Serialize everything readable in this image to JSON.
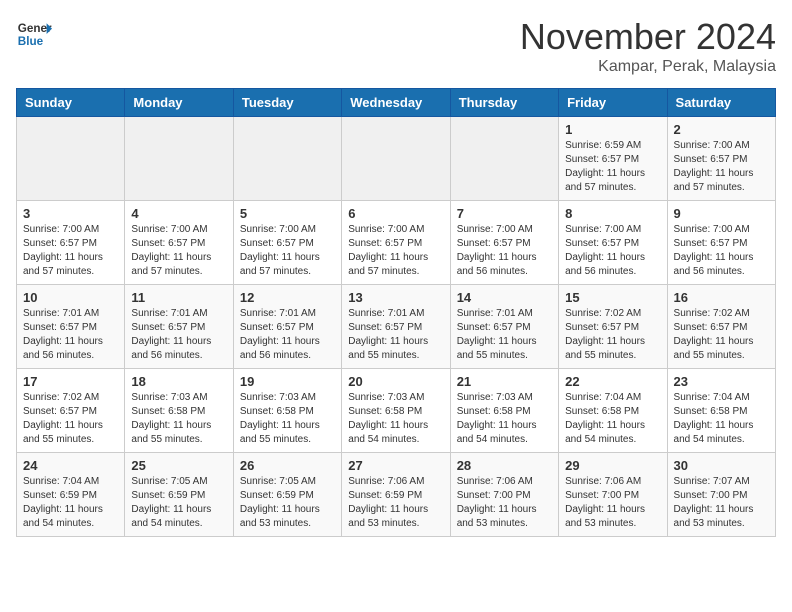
{
  "logo": {
    "general": "General",
    "blue": "Blue"
  },
  "title": "November 2024",
  "location": "Kampar, Perak, Malaysia",
  "weekdays": [
    "Sunday",
    "Monday",
    "Tuesday",
    "Wednesday",
    "Thursday",
    "Friday",
    "Saturday"
  ],
  "weeks": [
    [
      {
        "day": "",
        "info": ""
      },
      {
        "day": "",
        "info": ""
      },
      {
        "day": "",
        "info": ""
      },
      {
        "day": "",
        "info": ""
      },
      {
        "day": "",
        "info": ""
      },
      {
        "day": "1",
        "info": "Sunrise: 6:59 AM\nSunset: 6:57 PM\nDaylight: 11 hours and 57 minutes."
      },
      {
        "day": "2",
        "info": "Sunrise: 7:00 AM\nSunset: 6:57 PM\nDaylight: 11 hours and 57 minutes."
      }
    ],
    [
      {
        "day": "3",
        "info": "Sunrise: 7:00 AM\nSunset: 6:57 PM\nDaylight: 11 hours and 57 minutes."
      },
      {
        "day": "4",
        "info": "Sunrise: 7:00 AM\nSunset: 6:57 PM\nDaylight: 11 hours and 57 minutes."
      },
      {
        "day": "5",
        "info": "Sunrise: 7:00 AM\nSunset: 6:57 PM\nDaylight: 11 hours and 57 minutes."
      },
      {
        "day": "6",
        "info": "Sunrise: 7:00 AM\nSunset: 6:57 PM\nDaylight: 11 hours and 57 minutes."
      },
      {
        "day": "7",
        "info": "Sunrise: 7:00 AM\nSunset: 6:57 PM\nDaylight: 11 hours and 56 minutes."
      },
      {
        "day": "8",
        "info": "Sunrise: 7:00 AM\nSunset: 6:57 PM\nDaylight: 11 hours and 56 minutes."
      },
      {
        "day": "9",
        "info": "Sunrise: 7:00 AM\nSunset: 6:57 PM\nDaylight: 11 hours and 56 minutes."
      }
    ],
    [
      {
        "day": "10",
        "info": "Sunrise: 7:01 AM\nSunset: 6:57 PM\nDaylight: 11 hours and 56 minutes."
      },
      {
        "day": "11",
        "info": "Sunrise: 7:01 AM\nSunset: 6:57 PM\nDaylight: 11 hours and 56 minutes."
      },
      {
        "day": "12",
        "info": "Sunrise: 7:01 AM\nSunset: 6:57 PM\nDaylight: 11 hours and 56 minutes."
      },
      {
        "day": "13",
        "info": "Sunrise: 7:01 AM\nSunset: 6:57 PM\nDaylight: 11 hours and 55 minutes."
      },
      {
        "day": "14",
        "info": "Sunrise: 7:01 AM\nSunset: 6:57 PM\nDaylight: 11 hours and 55 minutes."
      },
      {
        "day": "15",
        "info": "Sunrise: 7:02 AM\nSunset: 6:57 PM\nDaylight: 11 hours and 55 minutes."
      },
      {
        "day": "16",
        "info": "Sunrise: 7:02 AM\nSunset: 6:57 PM\nDaylight: 11 hours and 55 minutes."
      }
    ],
    [
      {
        "day": "17",
        "info": "Sunrise: 7:02 AM\nSunset: 6:57 PM\nDaylight: 11 hours and 55 minutes."
      },
      {
        "day": "18",
        "info": "Sunrise: 7:03 AM\nSunset: 6:58 PM\nDaylight: 11 hours and 55 minutes."
      },
      {
        "day": "19",
        "info": "Sunrise: 7:03 AM\nSunset: 6:58 PM\nDaylight: 11 hours and 55 minutes."
      },
      {
        "day": "20",
        "info": "Sunrise: 7:03 AM\nSunset: 6:58 PM\nDaylight: 11 hours and 54 minutes."
      },
      {
        "day": "21",
        "info": "Sunrise: 7:03 AM\nSunset: 6:58 PM\nDaylight: 11 hours and 54 minutes."
      },
      {
        "day": "22",
        "info": "Sunrise: 7:04 AM\nSunset: 6:58 PM\nDaylight: 11 hours and 54 minutes."
      },
      {
        "day": "23",
        "info": "Sunrise: 7:04 AM\nSunset: 6:58 PM\nDaylight: 11 hours and 54 minutes."
      }
    ],
    [
      {
        "day": "24",
        "info": "Sunrise: 7:04 AM\nSunset: 6:59 PM\nDaylight: 11 hours and 54 minutes."
      },
      {
        "day": "25",
        "info": "Sunrise: 7:05 AM\nSunset: 6:59 PM\nDaylight: 11 hours and 54 minutes."
      },
      {
        "day": "26",
        "info": "Sunrise: 7:05 AM\nSunset: 6:59 PM\nDaylight: 11 hours and 53 minutes."
      },
      {
        "day": "27",
        "info": "Sunrise: 7:06 AM\nSunset: 6:59 PM\nDaylight: 11 hours and 53 minutes."
      },
      {
        "day": "28",
        "info": "Sunrise: 7:06 AM\nSunset: 7:00 PM\nDaylight: 11 hours and 53 minutes."
      },
      {
        "day": "29",
        "info": "Sunrise: 7:06 AM\nSunset: 7:00 PM\nDaylight: 11 hours and 53 minutes."
      },
      {
        "day": "30",
        "info": "Sunrise: 7:07 AM\nSunset: 7:00 PM\nDaylight: 11 hours and 53 minutes."
      }
    ]
  ]
}
